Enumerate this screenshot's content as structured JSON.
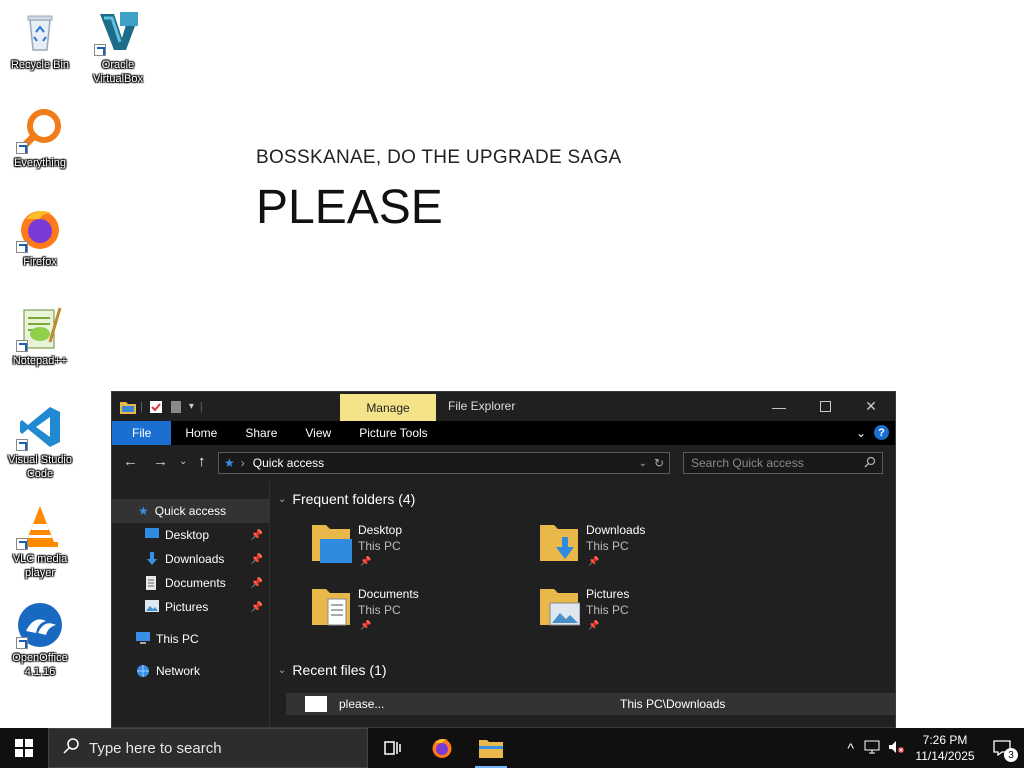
{
  "desktop": {
    "icons": [
      {
        "label": "Recycle Bin",
        "icon": "recycle-bin-icon"
      },
      {
        "label": "Oracle VirtualBox",
        "icon": "virtualbox-icon"
      },
      {
        "label": "Everything",
        "icon": "everything-search-icon"
      },
      {
        "label": "Firefox",
        "icon": "firefox-icon"
      },
      {
        "label": "Notepad++",
        "icon": "notepadpp-icon"
      },
      {
        "label": "Visual Studio Code",
        "icon": "vscode-icon"
      },
      {
        "label": "VLC media player",
        "icon": "vlc-icon"
      },
      {
        "label": "OpenOffice 4.1.16",
        "icon": "openoffice-icon"
      }
    ],
    "wallpaper_subtitle": "BOSSKANAE, DO THE UPGRADE SAGA",
    "wallpaper_title": "PLEASE"
  },
  "explorer": {
    "context_tab": "Manage",
    "title": "File Explorer",
    "ribbon_tabs": [
      "File",
      "Home",
      "Share",
      "View",
      "Picture Tools"
    ],
    "address": "Quick access",
    "search_placeholder": "Search Quick access",
    "nav": {
      "quick_access": "Quick access",
      "pinned": [
        {
          "label": "Desktop",
          "icon": "desktop-folder-icon"
        },
        {
          "label": "Downloads",
          "icon": "downloads-folder-icon"
        },
        {
          "label": "Documents",
          "icon": "documents-folder-icon"
        },
        {
          "label": "Pictures",
          "icon": "pictures-folder-icon"
        }
      ],
      "this_pc": "This PC",
      "network": "Network"
    },
    "frequent_header": "Frequent folders (4)",
    "frequent": [
      {
        "name": "Desktop",
        "location": "This PC"
      },
      {
        "name": "Downloads",
        "location": "This PC"
      },
      {
        "name": "Documents",
        "location": "This PC"
      },
      {
        "name": "Pictures",
        "location": "This PC"
      }
    ],
    "recent_header": "Recent files (1)",
    "recent": [
      {
        "name": "please...",
        "path": "This PC\\Downloads"
      }
    ]
  },
  "taskbar": {
    "search_placeholder": "Type here to search",
    "time": "7:26 PM",
    "date": "11/14/2025",
    "notification_count": "3"
  },
  "colors": {
    "accent": "#1a6fd1",
    "manage_tab": "#f5e38a",
    "window_bg": "#202020"
  }
}
